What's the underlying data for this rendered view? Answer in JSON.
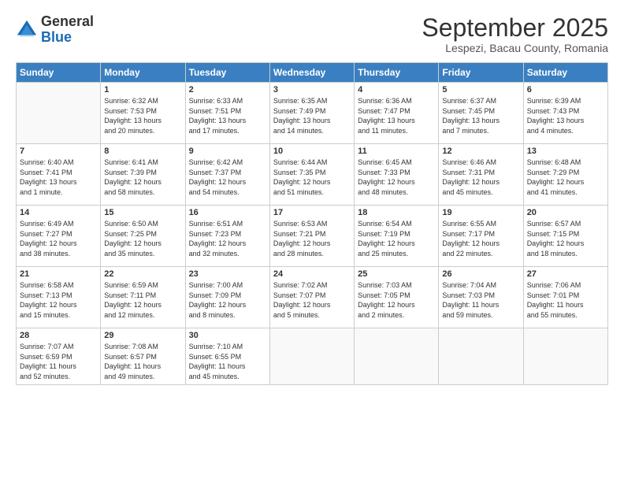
{
  "header": {
    "logo_general": "General",
    "logo_blue": "Blue",
    "month_title": "September 2025",
    "location": "Lespezi, Bacau County, Romania"
  },
  "weekdays": [
    "Sunday",
    "Monday",
    "Tuesday",
    "Wednesday",
    "Thursday",
    "Friday",
    "Saturday"
  ],
  "weeks": [
    [
      {
        "day": "",
        "content": ""
      },
      {
        "day": "1",
        "content": "Sunrise: 6:32 AM\nSunset: 7:53 PM\nDaylight: 13 hours\nand 20 minutes."
      },
      {
        "day": "2",
        "content": "Sunrise: 6:33 AM\nSunset: 7:51 PM\nDaylight: 13 hours\nand 17 minutes."
      },
      {
        "day": "3",
        "content": "Sunrise: 6:35 AM\nSunset: 7:49 PM\nDaylight: 13 hours\nand 14 minutes."
      },
      {
        "day": "4",
        "content": "Sunrise: 6:36 AM\nSunset: 7:47 PM\nDaylight: 13 hours\nand 11 minutes."
      },
      {
        "day": "5",
        "content": "Sunrise: 6:37 AM\nSunset: 7:45 PM\nDaylight: 13 hours\nand 7 minutes."
      },
      {
        "day": "6",
        "content": "Sunrise: 6:39 AM\nSunset: 7:43 PM\nDaylight: 13 hours\nand 4 minutes."
      }
    ],
    [
      {
        "day": "7",
        "content": "Sunrise: 6:40 AM\nSunset: 7:41 PM\nDaylight: 13 hours\nand 1 minute."
      },
      {
        "day": "8",
        "content": "Sunrise: 6:41 AM\nSunset: 7:39 PM\nDaylight: 12 hours\nand 58 minutes."
      },
      {
        "day": "9",
        "content": "Sunrise: 6:42 AM\nSunset: 7:37 PM\nDaylight: 12 hours\nand 54 minutes."
      },
      {
        "day": "10",
        "content": "Sunrise: 6:44 AM\nSunset: 7:35 PM\nDaylight: 12 hours\nand 51 minutes."
      },
      {
        "day": "11",
        "content": "Sunrise: 6:45 AM\nSunset: 7:33 PM\nDaylight: 12 hours\nand 48 minutes."
      },
      {
        "day": "12",
        "content": "Sunrise: 6:46 AM\nSunset: 7:31 PM\nDaylight: 12 hours\nand 45 minutes."
      },
      {
        "day": "13",
        "content": "Sunrise: 6:48 AM\nSunset: 7:29 PM\nDaylight: 12 hours\nand 41 minutes."
      }
    ],
    [
      {
        "day": "14",
        "content": "Sunrise: 6:49 AM\nSunset: 7:27 PM\nDaylight: 12 hours\nand 38 minutes."
      },
      {
        "day": "15",
        "content": "Sunrise: 6:50 AM\nSunset: 7:25 PM\nDaylight: 12 hours\nand 35 minutes."
      },
      {
        "day": "16",
        "content": "Sunrise: 6:51 AM\nSunset: 7:23 PM\nDaylight: 12 hours\nand 32 minutes."
      },
      {
        "day": "17",
        "content": "Sunrise: 6:53 AM\nSunset: 7:21 PM\nDaylight: 12 hours\nand 28 minutes."
      },
      {
        "day": "18",
        "content": "Sunrise: 6:54 AM\nSunset: 7:19 PM\nDaylight: 12 hours\nand 25 minutes."
      },
      {
        "day": "19",
        "content": "Sunrise: 6:55 AM\nSunset: 7:17 PM\nDaylight: 12 hours\nand 22 minutes."
      },
      {
        "day": "20",
        "content": "Sunrise: 6:57 AM\nSunset: 7:15 PM\nDaylight: 12 hours\nand 18 minutes."
      }
    ],
    [
      {
        "day": "21",
        "content": "Sunrise: 6:58 AM\nSunset: 7:13 PM\nDaylight: 12 hours\nand 15 minutes."
      },
      {
        "day": "22",
        "content": "Sunrise: 6:59 AM\nSunset: 7:11 PM\nDaylight: 12 hours\nand 12 minutes."
      },
      {
        "day": "23",
        "content": "Sunrise: 7:00 AM\nSunset: 7:09 PM\nDaylight: 12 hours\nand 8 minutes."
      },
      {
        "day": "24",
        "content": "Sunrise: 7:02 AM\nSunset: 7:07 PM\nDaylight: 12 hours\nand 5 minutes."
      },
      {
        "day": "25",
        "content": "Sunrise: 7:03 AM\nSunset: 7:05 PM\nDaylight: 12 hours\nand 2 minutes."
      },
      {
        "day": "26",
        "content": "Sunrise: 7:04 AM\nSunset: 7:03 PM\nDaylight: 11 hours\nand 59 minutes."
      },
      {
        "day": "27",
        "content": "Sunrise: 7:06 AM\nSunset: 7:01 PM\nDaylight: 11 hours\nand 55 minutes."
      }
    ],
    [
      {
        "day": "28",
        "content": "Sunrise: 7:07 AM\nSunset: 6:59 PM\nDaylight: 11 hours\nand 52 minutes."
      },
      {
        "day": "29",
        "content": "Sunrise: 7:08 AM\nSunset: 6:57 PM\nDaylight: 11 hours\nand 49 minutes."
      },
      {
        "day": "30",
        "content": "Sunrise: 7:10 AM\nSunset: 6:55 PM\nDaylight: 11 hours\nand 45 minutes."
      },
      {
        "day": "",
        "content": ""
      },
      {
        "day": "",
        "content": ""
      },
      {
        "day": "",
        "content": ""
      },
      {
        "day": "",
        "content": ""
      }
    ]
  ]
}
